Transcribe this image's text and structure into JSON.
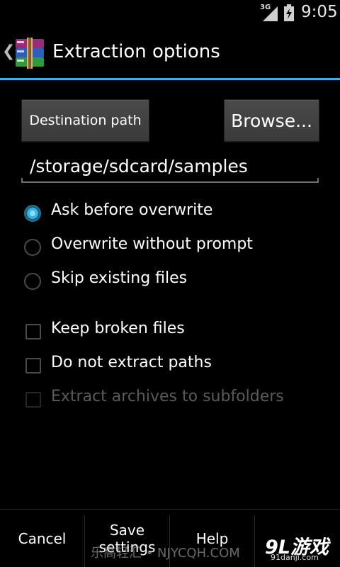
{
  "status_bar": {
    "network": "3G",
    "time": "9:05"
  },
  "action_bar": {
    "title": "Extraction options",
    "up_icon": "chevron-left-icon",
    "app_icon": "winrar-books-icon"
  },
  "destination": {
    "button_label": "Destination path",
    "browse_label": "Browse...",
    "path_value": "/storage/sdcard/samples"
  },
  "overwrite_mode": {
    "options": [
      {
        "label": "Ask before overwrite",
        "checked": true
      },
      {
        "label": "Overwrite without prompt",
        "checked": false
      },
      {
        "label": "Skip existing files",
        "checked": false
      }
    ]
  },
  "flags": {
    "options": [
      {
        "label": "Keep broken files",
        "checked": false,
        "enabled": true
      },
      {
        "label": "Do not extract paths",
        "checked": false,
        "enabled": true
      },
      {
        "label": "Extract archives to subfolders",
        "checked": false,
        "enabled": false
      }
    ]
  },
  "bottom_bar": {
    "cancel": "Cancel",
    "save": "Save settings",
    "help": "Help"
  },
  "watermarks": {
    "center": "乐高轻汇 • NJYCQH.COM",
    "logo": "9L游戏",
    "url": "91danji.com"
  },
  "colors": {
    "accent": "#33b5e5",
    "background": "#000000"
  }
}
